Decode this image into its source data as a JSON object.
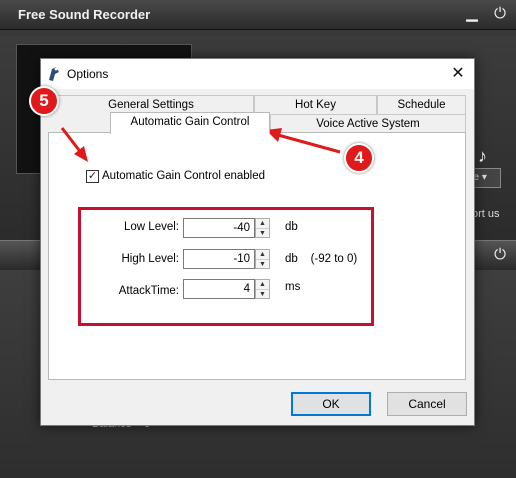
{
  "app": {
    "title": "Free Sound Recorder",
    "minimize_glyph": "▁",
    "power_glyph": "⏻",
    "dropdown_text": "de ▾",
    "support_text": "ort us",
    "balance_label": "Balance",
    "balance_value": "0"
  },
  "dialog": {
    "title": "Options",
    "close_glyph": "✕",
    "tabs": {
      "general": "General Settings",
      "hotkey": "Hot Key",
      "schedule": "Schedule",
      "agc": "Automatic Gain Control",
      "vas": "Voice Active System"
    },
    "agc": {
      "enabled_checked": true,
      "enabled_label": "Automatic Gain Control  enabled",
      "low_level_label": "Low Level:",
      "low_level_value": "-40",
      "low_level_unit": "db",
      "high_level_label": "High Level:",
      "high_level_value": "-10",
      "high_level_unit": "db    (-92 to 0)",
      "attack_time_label": "AttackTime:",
      "attack_time_value": "4",
      "attack_time_unit": "ms"
    },
    "ok_label": "OK",
    "cancel_label": "Cancel"
  },
  "annotations": {
    "badge_5": "5",
    "badge_4": "4",
    "color": "#e01a1a"
  }
}
